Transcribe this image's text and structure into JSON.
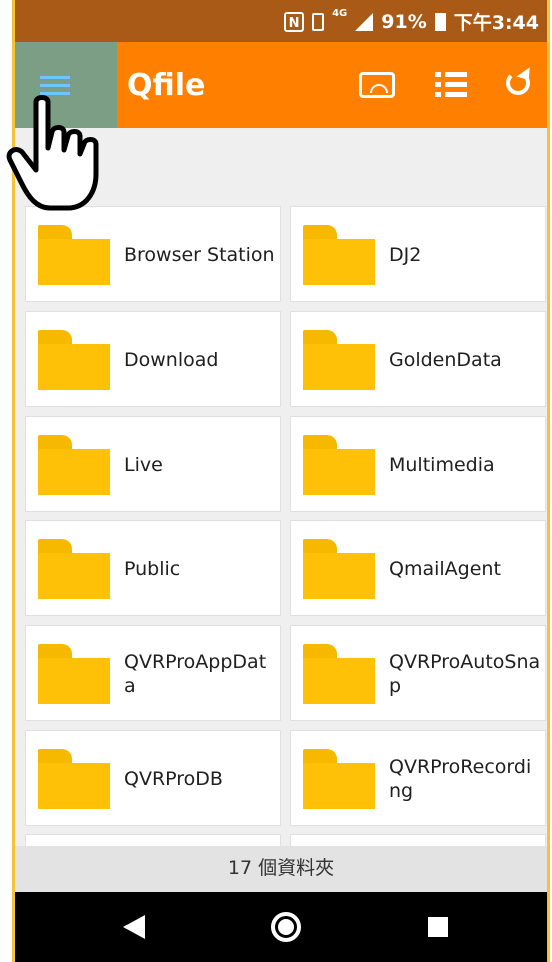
{
  "status_bar": {
    "nfc": "N",
    "network": "4G",
    "battery": "91%",
    "time": "下午3:44"
  },
  "app_bar": {
    "title": "Qfile",
    "icons": [
      "menu-icon",
      "cast-icon",
      "list-view-icon",
      "refresh-icon"
    ]
  },
  "folders": [
    {
      "name": "Browser Station"
    },
    {
      "name": "DJ2"
    },
    {
      "name": "Download"
    },
    {
      "name": "GoldenData"
    },
    {
      "name": "Live"
    },
    {
      "name": "Multimedia"
    },
    {
      "name": "Public"
    },
    {
      "name": "QmailAgent"
    },
    {
      "name": "QVRProAppData"
    },
    {
      "name": "QVRProAutoSnap"
    },
    {
      "name": "QVRProDB"
    },
    {
      "name": "QVRProRecording"
    }
  ],
  "footer": {
    "folder_count_text": "17 個資料夾"
  },
  "colors": {
    "app_bar": "#ff7f00",
    "status_bar": "#a85a16",
    "folder": "#ffc107",
    "highlight": "#7c9e84"
  }
}
